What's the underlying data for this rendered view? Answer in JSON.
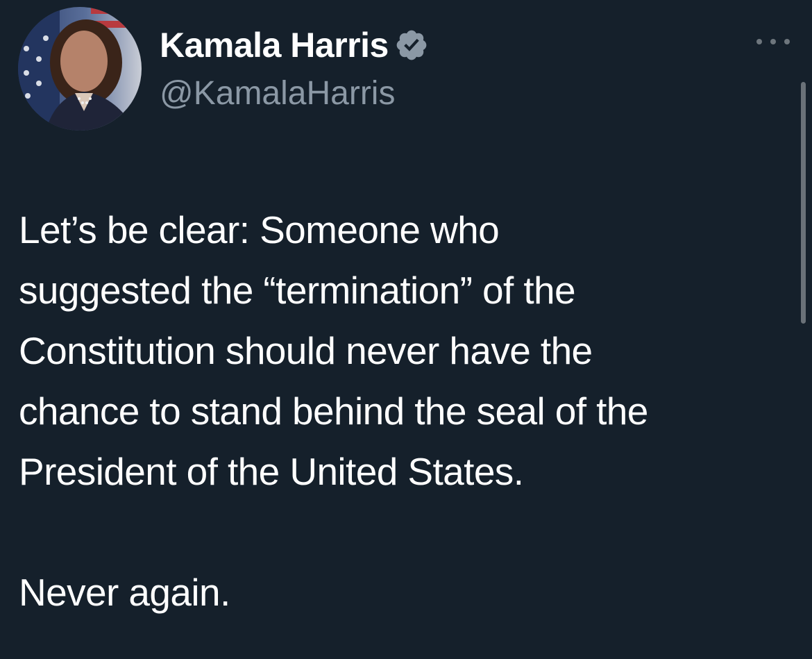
{
  "author": {
    "display_name": "Kamala Harris",
    "handle": "@KamalaHarris",
    "verified": true,
    "avatar_icon": "profile-photo"
  },
  "tweet": {
    "lines": [
      "Let’s be clear: Someone who",
      "suggested the “termination” of the",
      "Constitution should never have the",
      "chance to stand behind the seal of the",
      "President of the United States.",
      "Never again."
    ]
  },
  "menu": {
    "icon": "more-icon"
  },
  "colors": {
    "background": "#15202b",
    "text_primary": "#ffffff",
    "text_secondary": "#8b98a5",
    "verified_badge": "#8b98a5"
  }
}
